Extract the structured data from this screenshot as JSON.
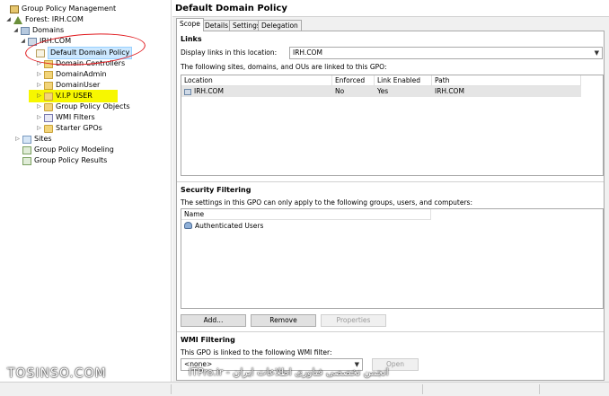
{
  "tree": {
    "root": "Group Policy Management",
    "forest": "Forest: IRH.COM",
    "domains": "Domains",
    "domain": "IRH.COM",
    "default_policy": "Default Domain Policy",
    "domain_controllers": "Domain Controllers",
    "domain_admin": "DomainAdmin",
    "domain_user": "DomainUser",
    "vip_user": "V.I.P USER",
    "gpo": "Group Policy Objects",
    "wmi": "WMI Filters",
    "starter": "Starter GPOs",
    "sites": "Sites",
    "modeling": "Group Policy Modeling",
    "results": "Group Policy Results"
  },
  "panel": {
    "title": "Default Domain Policy",
    "tabs": [
      "Scope",
      "Details",
      "Settings",
      "Delegation"
    ],
    "links": {
      "heading": "Links",
      "display_label": "Display links in this location:",
      "location_value": "IRH.COM",
      "linked_label": "The following sites, domains, and OUs are linked to this GPO:",
      "columns": [
        "Location",
        "Enforced",
        "Link Enabled",
        "Path"
      ],
      "rows": [
        {
          "location": "IRH.COM",
          "enforced": "No",
          "link_enabled": "Yes",
          "path": "IRH.COM"
        }
      ]
    },
    "security": {
      "heading": "Security Filtering",
      "desc": "The settings in this GPO can only apply to the following groups, users, and computers:",
      "column": "Name",
      "rows": [
        "Authenticated Users"
      ],
      "add": "Add...",
      "remove": "Remove",
      "properties": "Properties"
    },
    "wmi": {
      "heading": "WMI Filtering",
      "desc": "This GPO is linked to the following WMI filter:",
      "value": "<none>",
      "open": "Open"
    }
  },
  "watermark": {
    "left": "TOSINSO.COM",
    "right": "ITPro.ir - انجمن تخصصی فناوری اطلاعات ایران"
  }
}
